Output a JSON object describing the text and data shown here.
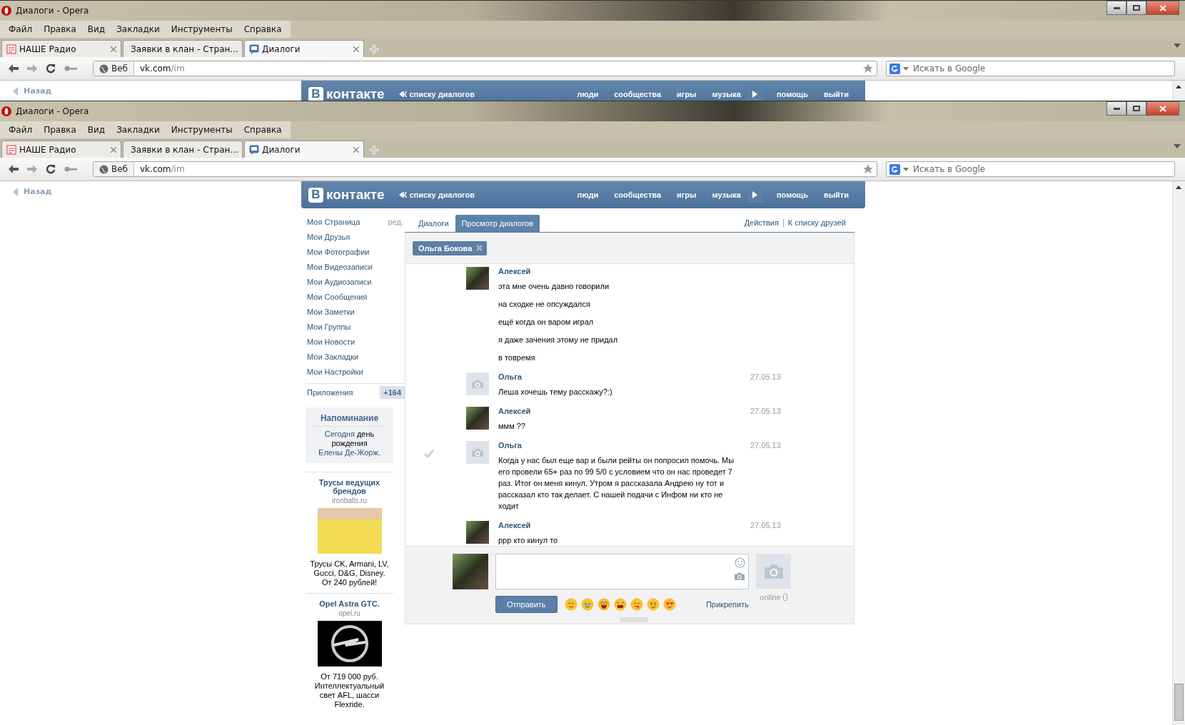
{
  "windows": [
    {
      "title": "Диалоги - Opera",
      "menu": [
        "Файл",
        "Правка",
        "Вид",
        "Закладки",
        "Инструменты",
        "Справка"
      ],
      "tabs": [
        {
          "label": "НАШЕ Радио",
          "selected": false
        },
        {
          "label": "Заявки в клан - Стран...",
          "selected": false
        },
        {
          "label": "Диалоги",
          "selected": true
        }
      ],
      "address": {
        "badge": "Веб",
        "host": "vk.com",
        "path": "/im"
      },
      "search": {
        "placeholder": "Искать в Google"
      },
      "page": {
        "back_link": "Назад",
        "header": {
          "logo_mark": "В",
          "logo_text": "контакте",
          "back_to_list": "К списку диалогов",
          "nav": [
            "люди",
            "сообщества",
            "игры",
            "музыка",
            "помощь",
            "выйти"
          ]
        }
      }
    },
    {
      "title": "Диалоги - Opera",
      "menu": [
        "Файл",
        "Правка",
        "Вид",
        "Закладки",
        "Инструменты",
        "Справка"
      ],
      "tabs": [
        {
          "label": "НАШЕ Радио",
          "selected": false
        },
        {
          "label": "Заявки в клан - Стран...",
          "selected": false
        },
        {
          "label": "Диалоги",
          "selected": true
        }
      ],
      "address": {
        "badge": "Веб",
        "host": "vk.com",
        "path": "/im"
      },
      "search": {
        "placeholder": "Искать в Google"
      },
      "page": {
        "back_link": "Назад",
        "header": {
          "logo_mark": "В",
          "logo_text": "контакте",
          "back_to_list": "К списку диалогов",
          "nav": [
            "люди",
            "сообщества",
            "игры",
            "музыка",
            "помощь",
            "выйти"
          ]
        },
        "sidebar": {
          "items": [
            "Моя Страница",
            "Мои Друзья",
            "Мои Фотографии",
            "Мои Видеозаписи",
            "Мои Аудиозаписи",
            "Мои Сообщения",
            "Мои Заметки",
            "Мои Группы",
            "Мои Новости",
            "Мои Закладки",
            "Мои Настройки"
          ],
          "edit_link": "ред.",
          "apps": {
            "label": "Приложения",
            "count": "+164"
          },
          "reminder": {
            "title": "Напоминание",
            "parts": [
              {
                "text": "Сегодня",
                "link": true
              },
              {
                "text": " день рождения ",
                "link": false
              },
              {
                "text": "Елены Де-Жорж",
                "link": true
              },
              {
                "text": ".",
                "link": false
              }
            ]
          },
          "ads": [
            {
              "title": "Трусы ведущих брендов",
              "domain": "ironballs.ru",
              "text": "Трусы CK, Armani, LV, Gucci, D&G, Disney. От 240 рублей!"
            },
            {
              "title": "Opel Astra GTC.",
              "domain": "opel.ru",
              "text": "От 719 000 руб. Интеллектуальный свет AFL, шасси Flexride."
            }
          ]
        },
        "dialog": {
          "tabs": [
            {
              "label": "Диалоги",
              "selected": false
            },
            {
              "label": "Просмотр диалогов",
              "selected": true
            }
          ],
          "actions": [
            "Действия",
            "К списку друзей"
          ],
          "recipient": "Ольга Бокова",
          "messages": [
            {
              "author": "Алексей",
              "kind": "photo",
              "marked": false,
              "lines": [
                "эта мне очень давно говорили",
                "на сходке не опсуждался",
                "ещё когда он варом играл",
                "я даже зачения этому не придал",
                "в товремя"
              ]
            },
            {
              "author": "Ольга",
              "kind": "nophoto",
              "date": "27.05.13",
              "marked": false,
              "lines": [
                "Леша хочешь тему расскажу?:)"
              ]
            },
            {
              "author": "Алексей",
              "kind": "photo",
              "date": "27.05.13",
              "marked": false,
              "lines": [
                "ммм ??"
              ]
            },
            {
              "author": "Ольга",
              "kind": "nophoto",
              "date": "27.05.13",
              "marked": true,
              "lines": [
                "Когда у нас был еще вар и были рейты он попросил помочь. Мы его провели 65+ раз по 99 5/0 с условием что он нас проведет 7 раз. Итог он меня кинул. Утром я рассказала Андрею ну тот и рассказал кто так делает. С нашей подачи с Инфом ни кто не ходит"
              ]
            },
            {
              "author": "Алексей",
              "kind": "photo",
              "date": "27.05.13",
              "marked": false,
              "lines": [
                "ррр кто кинул то"
              ]
            }
          ],
          "composer": {
            "send": "Отправить",
            "attach": "Прикрепить",
            "status": "online",
            "emojis": [
              {
                "kind": "blush"
              },
              {
                "kind": "cry"
              },
              {
                "kind": "laugh"
              },
              {
                "kind": "shock"
              },
              {
                "kind": "tongue"
              },
              {
                "kind": "squint"
              },
              {
                "kind": "love"
              }
            ]
          }
        }
      }
    }
  ]
}
